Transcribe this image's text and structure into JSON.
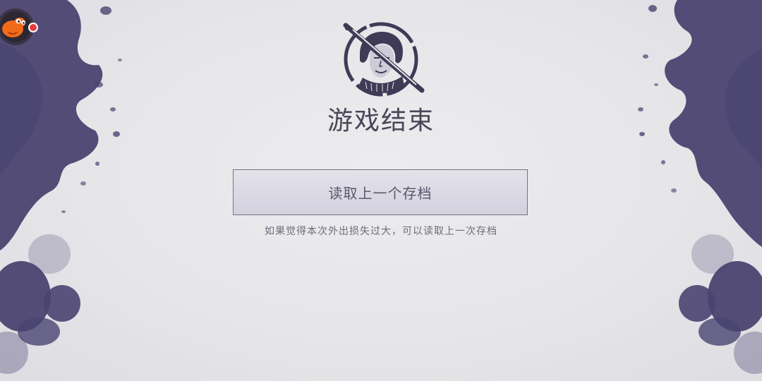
{
  "game_over": {
    "title": "游戏结束",
    "load_button_label": "读取上一个存档",
    "hint": "如果觉得本次外出损失过大，可以读取上一次存档"
  },
  "colors": {
    "ink": "#4a4370",
    "title_text": "#4a4658",
    "button_border": "#77727f",
    "button_fill": "#d8d5e2",
    "badge_orange": "#f06a1a",
    "badge_dot": "#e83b3b"
  },
  "icons": {
    "corner_badge": "orange-mascot-icon",
    "notification": "red-dot-icon",
    "emblem": "hooded-survivor-portrait-icon"
  }
}
